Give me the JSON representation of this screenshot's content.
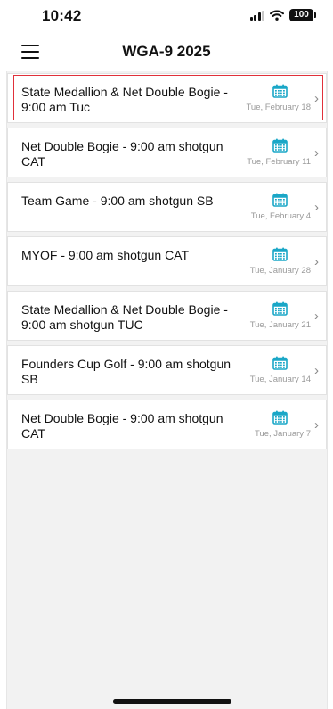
{
  "status_bar": {
    "time": "10:42",
    "battery": "100"
  },
  "header": {
    "title": "WGA-9 2025"
  },
  "colors": {
    "accent": "#1aa7c7",
    "selection": "#e0303a"
  },
  "events": [
    {
      "title": "State Medallion & Net Double Bogie - 9:00 am Tuc",
      "date": "Tue, February 18",
      "icon": "calendar-icon",
      "selected": true
    },
    {
      "title": "Net Double Bogie - 9:00 am shotgun CAT",
      "date": "Tue, February 11",
      "icon": "calendar-icon",
      "selected": false
    },
    {
      "title": "Team Game - 9:00 am shotgun SB",
      "date": "Tue, February  4",
      "icon": "calendar-icon",
      "selected": false
    },
    {
      "title": "MYOF -  9:00 am shotgun CAT",
      "date": "Tue, January 28",
      "icon": "calendar-icon",
      "selected": false
    },
    {
      "title": "State Medallion & Net Double Bogie - 9:00 am shotgun TUC",
      "date": "Tue, January 21",
      "icon": "calendar-icon",
      "selected": false
    },
    {
      "title": "Founders Cup Golf - 9:00 am shotgun SB",
      "date": "Tue, January 14",
      "icon": "calendar-icon",
      "selected": false
    },
    {
      "title": "Net Double Bogie - 9:00 am shotgun CAT",
      "date": "Tue, January  7",
      "icon": "calendar-icon",
      "selected": false
    }
  ]
}
